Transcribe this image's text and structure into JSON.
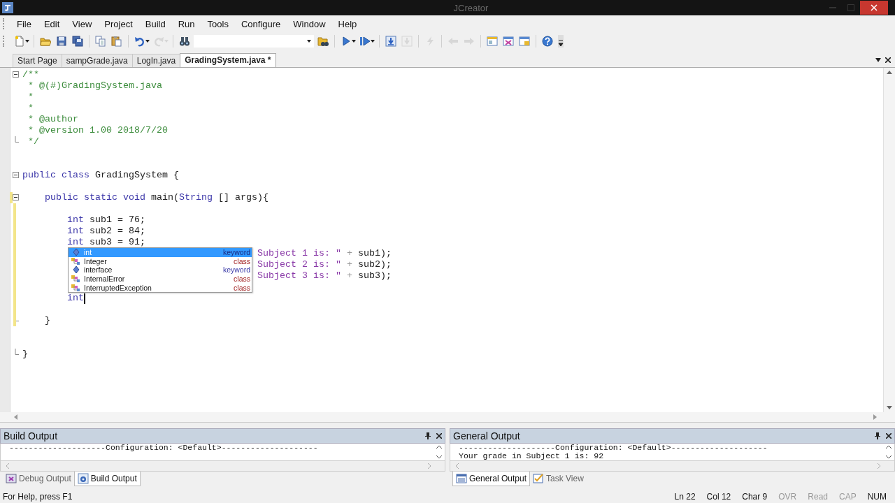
{
  "window": {
    "title": "JCreator"
  },
  "menu": [
    "File",
    "Edit",
    "View",
    "Project",
    "Build",
    "Run",
    "Tools",
    "Configure",
    "Window",
    "Help"
  ],
  "toolbar": [
    {
      "kind": "new",
      "disabled": false,
      "dropdown": true
    },
    {
      "kind": "separator"
    },
    {
      "kind": "open",
      "disabled": false,
      "dropdown": false
    },
    {
      "kind": "save",
      "disabled": false,
      "dropdown": false
    },
    {
      "kind": "saveall",
      "disabled": false,
      "dropdown": false
    },
    {
      "kind": "separator"
    },
    {
      "kind": "copy",
      "disabled": false,
      "dropdown": false
    },
    {
      "kind": "paste",
      "disabled": false,
      "dropdown": false
    },
    {
      "kind": "separator"
    },
    {
      "kind": "undo",
      "disabled": false,
      "dropdown": true
    },
    {
      "kind": "redo",
      "disabled": true,
      "dropdown": true
    },
    {
      "kind": "separator"
    },
    {
      "kind": "find",
      "disabled": false,
      "dropdown": false
    },
    {
      "kind": "combo",
      "disabled": false,
      "dropdown": true
    },
    {
      "kind": "findfiles",
      "disabled": false,
      "dropdown": false
    },
    {
      "kind": "separator"
    },
    {
      "kind": "run",
      "disabled": false,
      "dropdown": true
    },
    {
      "kind": "debug",
      "disabled": false,
      "dropdown": true
    },
    {
      "kind": "separator"
    },
    {
      "kind": "stepin",
      "disabled": false,
      "dropdown": false
    },
    {
      "kind": "stepout",
      "disabled": true,
      "dropdown": false
    },
    {
      "kind": "separator"
    },
    {
      "kind": "lightning",
      "disabled": true,
      "dropdown": false
    },
    {
      "kind": "separator"
    },
    {
      "kind": "back",
      "disabled": true,
      "dropdown": false
    },
    {
      "kind": "forward",
      "disabled": true,
      "dropdown": false
    },
    {
      "kind": "separator"
    },
    {
      "kind": "window1",
      "disabled": false,
      "dropdown": false
    },
    {
      "kind": "window2",
      "disabled": false,
      "dropdown": false
    },
    {
      "kind": "window3",
      "disabled": false,
      "dropdown": false
    },
    {
      "kind": "separator"
    },
    {
      "kind": "help",
      "disabled": false,
      "dropdown": false
    }
  ],
  "tabs": [
    {
      "label": "Start Page",
      "selected": false
    },
    {
      "label": "sampGrade.java",
      "selected": false
    },
    {
      "label": "LogIn.java",
      "selected": false
    },
    {
      "label": "GradingSystem.java *",
      "selected": true
    }
  ],
  "editor": {
    "lines": [
      {
        "kind": "fold-start",
        "changed": false,
        "caret": false,
        "tokens": [
          {
            "kind": "comment",
            "text": "/**"
          }
        ]
      },
      {
        "kind": "code",
        "changed": false,
        "caret": false,
        "tokens": [
          {
            "kind": "comment",
            "text": " * @(#)GradingSystem.java"
          }
        ]
      },
      {
        "kind": "code",
        "changed": false,
        "caret": false,
        "tokens": [
          {
            "kind": "comment",
            "text": " *"
          }
        ]
      },
      {
        "kind": "code",
        "changed": false,
        "caret": false,
        "tokens": [
          {
            "kind": "comment",
            "text": " *"
          }
        ]
      },
      {
        "kind": "code",
        "changed": false,
        "caret": false,
        "tokens": [
          {
            "kind": "comment",
            "text": " * @author"
          }
        ]
      },
      {
        "kind": "code",
        "changed": false,
        "caret": false,
        "tokens": [
          {
            "kind": "comment",
            "text": " * @version 1.00 2018/7/20"
          }
        ]
      },
      {
        "kind": "fold-end",
        "changed": false,
        "caret": false,
        "tokens": [
          {
            "kind": "comment",
            "text": " */"
          }
        ]
      },
      {
        "kind": "code",
        "changed": false,
        "caret": false
      },
      {
        "kind": "code",
        "changed": false,
        "caret": false
      },
      {
        "kind": "fold-start",
        "changed": false,
        "caret": false,
        "tokens": [
          {
            "kind": "keyword",
            "text": "public class"
          },
          {
            "kind": "plain",
            "text": " GradingSystem {"
          }
        ]
      },
      {
        "kind": "code",
        "changed": false,
        "caret": false
      },
      {
        "kind": "fold-start",
        "changed": true,
        "caret": false,
        "tokens": [
          {
            "kind": "keyword",
            "text": "    public static void"
          },
          {
            "kind": "plain",
            "text": " main("
          },
          {
            "kind": "keyword",
            "text": "String"
          },
          {
            "kind": "plain",
            "text": " [] args){"
          }
        ]
      },
      {
        "kind": "code",
        "changed": true,
        "caret": false
      },
      {
        "kind": "code",
        "changed": true,
        "caret": false,
        "tokens": [
          {
            "kind": "keyword",
            "text": "        int"
          },
          {
            "kind": "plain",
            "text": " sub1 = 76;"
          }
        ]
      },
      {
        "kind": "code",
        "changed": true,
        "caret": false,
        "tokens": [
          {
            "kind": "keyword",
            "text": "        int"
          },
          {
            "kind": "plain",
            "text": " sub2 = 84;"
          }
        ]
      },
      {
        "kind": "code",
        "changed": true,
        "caret": false,
        "tokens": [
          {
            "kind": "keyword",
            "text": "        int"
          },
          {
            "kind": "plain",
            "text": " sub3 = 91;"
          }
        ]
      },
      {
        "kind": "code",
        "changed": true,
        "caret": false,
        "tokens": [
          {
            "kind": "string",
            "text": "                                          Subject 1 is: \""
          },
          {
            "kind": "operator",
            "text": " + "
          },
          {
            "kind": "plain",
            "text": "sub1);"
          }
        ]
      },
      {
        "kind": "code",
        "changed": true,
        "caret": false,
        "tokens": [
          {
            "kind": "string",
            "text": "                                          Subject 2 is: \""
          },
          {
            "kind": "operator",
            "text": " + "
          },
          {
            "kind": "plain",
            "text": "sub2);"
          }
        ]
      },
      {
        "kind": "code",
        "changed": true,
        "caret": false,
        "tokens": [
          {
            "kind": "string",
            "text": "                                          Subject 3 is: \""
          },
          {
            "kind": "operator",
            "text": " + "
          },
          {
            "kind": "plain",
            "text": "sub3);"
          }
        ]
      },
      {
        "kind": "code",
        "changed": true,
        "caret": false
      },
      {
        "kind": "code",
        "changed": true,
        "caret": true,
        "tokens": [
          {
            "kind": "keyword",
            "text": "        int"
          }
        ]
      },
      {
        "kind": "code",
        "changed": true,
        "caret": false
      },
      {
        "kind": "fold-end",
        "changed": true,
        "caret": false,
        "tokens": [
          {
            "kind": "plain",
            "text": "    }"
          }
        ]
      },
      {
        "kind": "code",
        "changed": false,
        "caret": false
      },
      {
        "kind": "code",
        "changed": false,
        "caret": false
      },
      {
        "kind": "fold-end",
        "changed": false,
        "caret": false,
        "tokens": [
          {
            "kind": "plain",
            "text": "}"
          }
        ]
      }
    ]
  },
  "completion": {
    "items": [
      {
        "label": "int",
        "category": "keyword",
        "kind": "keyword",
        "selected": true
      },
      {
        "label": "Integer",
        "category": "class",
        "kind": "class",
        "selected": false
      },
      {
        "label": "interface",
        "category": "keyword",
        "kind": "keyword",
        "selected": false
      },
      {
        "label": "InternalError",
        "category": "class",
        "kind": "class",
        "selected": false
      },
      {
        "label": "InterruptedException",
        "category": "class",
        "kind": "class",
        "selected": false
      }
    ]
  },
  "panels": [
    {
      "title": "Build Output",
      "lines": [
        "--------------------Configuration: <Default>--------------------"
      ],
      "tabs": [
        {
          "label": "Debug Output",
          "kind": "debug",
          "selected": false
        },
        {
          "label": "Build Output",
          "kind": "build",
          "selected": true
        }
      ]
    },
    {
      "title": "General Output",
      "lines": [
        "--------------------Configuration: <Default>--------------------",
        "Your grade in Subject 1 is: 92"
      ],
      "tabs": [
        {
          "label": "General Output",
          "kind": "general",
          "selected": true
        },
        {
          "label": "Task View",
          "kind": "task",
          "selected": false
        }
      ]
    }
  ],
  "status_bar": {
    "message": "For Help, press F1",
    "indicators": [
      {
        "label": "Ln 22",
        "on": true
      },
      {
        "label": "Col 12",
        "on": true
      },
      {
        "label": "Char 9",
        "on": true
      },
      {
        "label": "OVR",
        "on": false
      },
      {
        "label": "Read",
        "on": false
      },
      {
        "label": "CAP",
        "on": false
      },
      {
        "label": "NUM",
        "on": true
      }
    ]
  }
}
